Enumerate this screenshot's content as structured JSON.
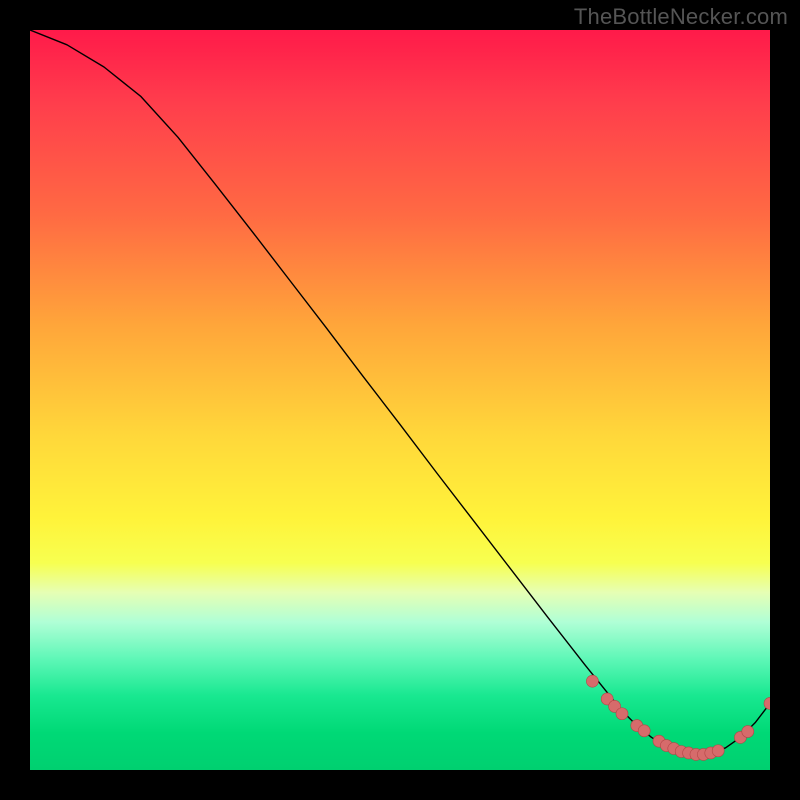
{
  "watermark": "TheBottleNecker.com",
  "chart_data": {
    "type": "line",
    "title": "",
    "xlabel": "",
    "ylabel": "",
    "xlim": [
      0,
      100
    ],
    "ylim": [
      0,
      100
    ],
    "x": [
      0,
      5,
      10,
      15,
      20,
      25,
      30,
      35,
      40,
      45,
      50,
      55,
      60,
      65,
      70,
      75,
      80,
      82,
      84,
      86,
      88,
      90,
      92,
      94,
      96,
      98,
      100
    ],
    "values": [
      100,
      98,
      95,
      91,
      85.5,
      79.2,
      72.8,
      66.3,
      59.8,
      53.2,
      46.7,
      40.1,
      33.6,
      27.1,
      20.6,
      14.2,
      8.0,
      6.0,
      4.4,
      3.2,
      2.4,
      2.0,
      2.2,
      3.0,
      4.4,
      6.4,
      9.0
    ],
    "markers": [
      {
        "x": 76,
        "y": 12.0
      },
      {
        "x": 78,
        "y": 9.6
      },
      {
        "x": 79,
        "y": 8.6
      },
      {
        "x": 80,
        "y": 7.6
      },
      {
        "x": 82,
        "y": 6.0
      },
      {
        "x": 83,
        "y": 5.3
      },
      {
        "x": 85,
        "y": 3.9
      },
      {
        "x": 86,
        "y": 3.3
      },
      {
        "x": 87,
        "y": 2.9
      },
      {
        "x": 88,
        "y": 2.5
      },
      {
        "x": 89,
        "y": 2.3
      },
      {
        "x": 90,
        "y": 2.1
      },
      {
        "x": 91,
        "y": 2.1
      },
      {
        "x": 92,
        "y": 2.3
      },
      {
        "x": 93,
        "y": 2.6
      },
      {
        "x": 96,
        "y": 4.4
      },
      {
        "x": 97,
        "y": 5.2
      },
      {
        "x": 100,
        "y": 9.0
      }
    ],
    "marker_radius": 6
  }
}
